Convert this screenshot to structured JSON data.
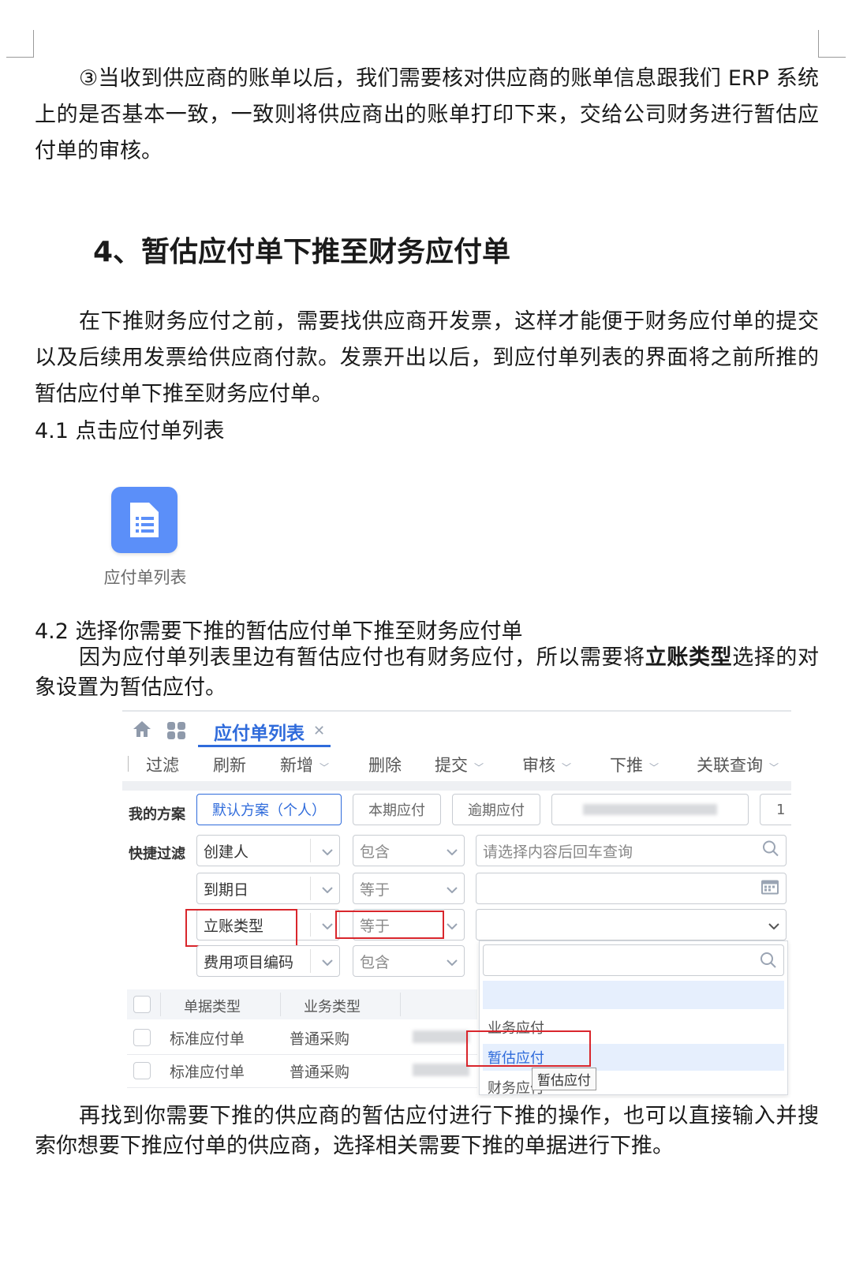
{
  "intro_paragraph": "③当收到供应商的账单以后，我们需要核对供应商的账单信息跟我们 ERP 系统上的是否基本一致，一致则将供应商出的账单打印下来，交给公司财务进行暂估应付单的审核。",
  "section_heading": "4、暂估应付单下推至财务应付单",
  "section_paragraph": "在下推财务应付之前，需要找供应商开发票，这样才能便于财务应付单的提交以及后续用发票给供应商付款。发票开出以后，到应付单列表的界面将之前所推的暂估应付单下推至财务应付单。",
  "step_4_1": "4.1 点击应付单列表",
  "app_icon": {
    "icon": "document-list-icon",
    "label": "应付单列表",
    "color": "#5b8ff9"
  },
  "step_4_2": "4.2 选择你需要下推的暂估应付单下推至财务应付单",
  "step_4_2_text": {
    "before": "因为应付单列表里边有暂估应付也有财务应付，所以需要将",
    "bold": "立账类型",
    "after": "选择的对象设置为暂估应付。"
  },
  "screenshot": {
    "tab_title": "应付单列表",
    "toolbar": [
      "过滤",
      "刷新",
      "新增",
      "删除",
      "提交",
      "审核",
      "下推",
      "关联查询"
    ],
    "scheme_label": "我的方案",
    "schemes": [
      "默认方案（个人）",
      "本期应付",
      "逾期应付"
    ],
    "scheme_extra": "1",
    "quick_filter_label": "快捷过滤",
    "filters": [
      {
        "field": "创建人",
        "op": "包含",
        "value_placeholder": "请选择内容后回车查询"
      },
      {
        "field": "到期日",
        "op": "等于"
      },
      {
        "field": "立账类型",
        "op": "等于"
      },
      {
        "field": "费用项目编码",
        "op": "包含"
      }
    ],
    "dropdown_options": [
      "业务应付",
      "暂估应付",
      "财务应付"
    ],
    "tooltip": "暂估应付",
    "table_headers": [
      "单据类型",
      "业务类型"
    ],
    "table_rows": [
      [
        "标准应付单",
        "普通采购"
      ],
      [
        "标准应付单",
        "普通采购"
      ]
    ],
    "accent": "#2f6bdb",
    "highlight_color": "#d9262c"
  },
  "closing_paragraph": "再找到你需要下推的供应商的暂估应付进行下推的操作，也可以直接输入并搜索你想要下推应付单的供应商，选择相关需要下推的单据进行下推。"
}
